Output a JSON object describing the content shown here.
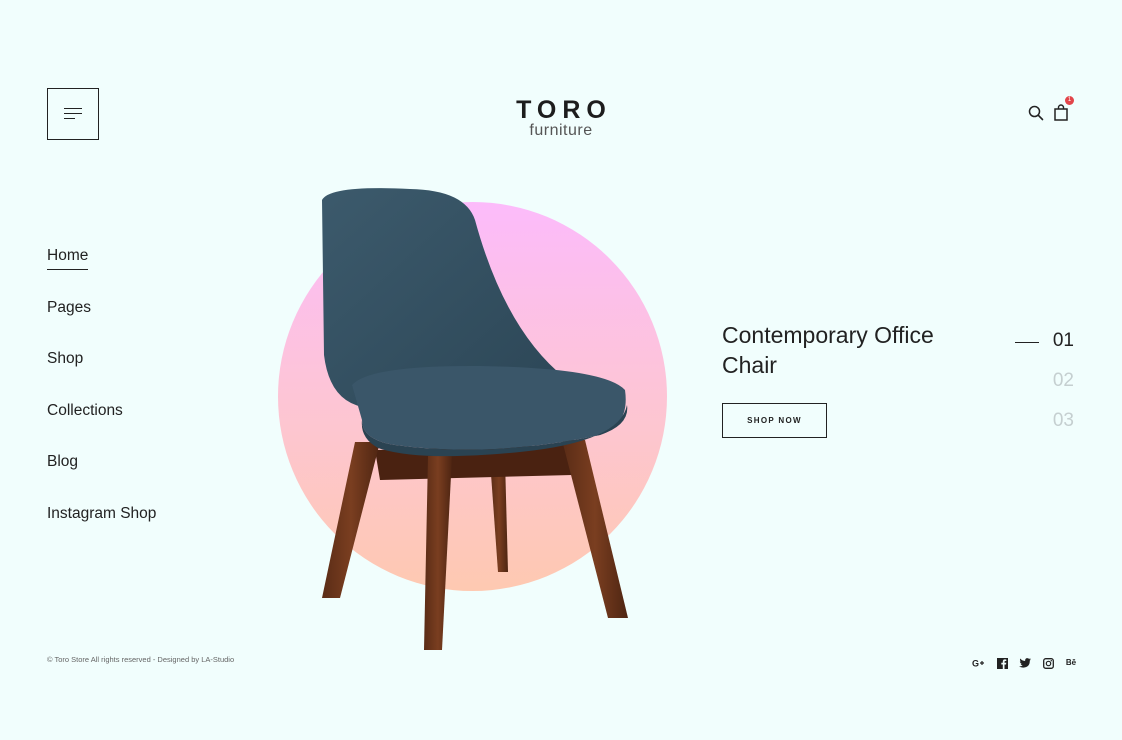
{
  "header": {
    "logo_main": "TORO",
    "logo_sub": "furniture",
    "cart_count": "1"
  },
  "nav": {
    "items": [
      {
        "label": "Home"
      },
      {
        "label": "Pages"
      },
      {
        "label": "Shop"
      },
      {
        "label": "Collections"
      },
      {
        "label": "Blog"
      },
      {
        "label": "Instagram Shop"
      }
    ],
    "active_index": 0
  },
  "hero": {
    "title_line1": "Contemporary Office",
    "title_line2": "Chair",
    "cta_label": "SHOP NOW",
    "circle_gradient": [
      "#fcbbfb",
      "#fec9b1"
    ]
  },
  "pager": {
    "items": [
      "01",
      "02",
      "03"
    ],
    "active_index": 0
  },
  "footer": {
    "copyright": "© Toro Store All rights reserved - Designed by LA-Studio",
    "social": [
      "google-plus-icon",
      "facebook-icon",
      "twitter-icon",
      "instagram-icon",
      "behance-icon"
    ],
    "behance_label": "Bē"
  },
  "colors": {
    "background": "#f1fefd",
    "text": "#222222",
    "badge": "#e2454a",
    "pager_inactive": "#c5cfd0"
  }
}
